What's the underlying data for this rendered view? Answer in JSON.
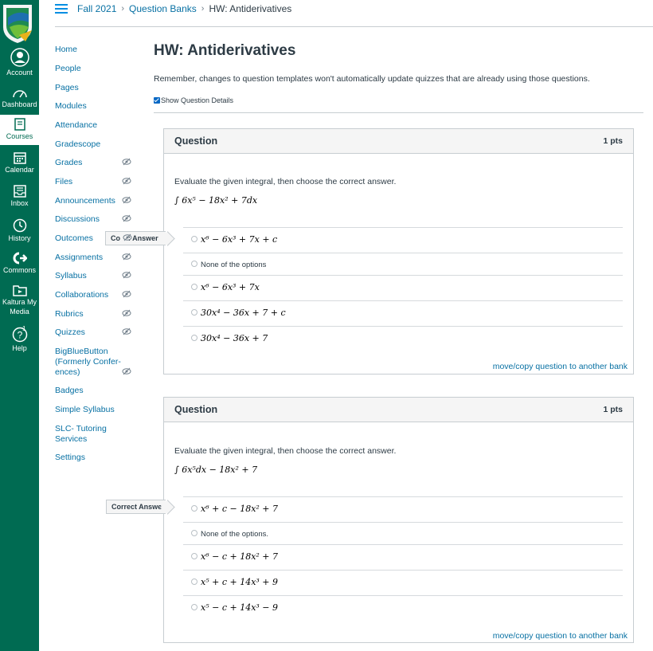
{
  "global_nav": {
    "items": [
      {
        "label": "Account",
        "icon": "account-icon"
      },
      {
        "label": "Dashboard",
        "icon": "dashboard-icon"
      },
      {
        "label": "Courses",
        "icon": "courses-icon"
      },
      {
        "label": "Calendar",
        "icon": "calendar-icon"
      },
      {
        "label": "Inbox",
        "icon": "inbox-icon"
      },
      {
        "label": "History",
        "icon": "history-icon"
      },
      {
        "label": "Commons",
        "icon": "commons-icon"
      },
      {
        "label": "Kaltura My Media",
        "icon": "kaltura-icon"
      },
      {
        "label": "Help",
        "icon": "help-icon",
        "badge": "1"
      }
    ],
    "active": "Courses",
    "colors": {
      "background": "#006b52",
      "accent": "#ffffff"
    }
  },
  "breadcrumb": {
    "items": [
      "Fall 2021",
      "Question Banks",
      "HW: Antiderivatives"
    ]
  },
  "course_nav": {
    "items": [
      {
        "label": "Home",
        "hidden": false
      },
      {
        "label": "People",
        "hidden": false
      },
      {
        "label": "Pages",
        "hidden": false
      },
      {
        "label": "Modules",
        "hidden": false
      },
      {
        "label": "Attendance",
        "hidden": false
      },
      {
        "label": "Gradescope",
        "hidden": false
      },
      {
        "label": "Grades",
        "hidden": true
      },
      {
        "label": "Files",
        "hidden": true
      },
      {
        "label": "Announcements",
        "hidden": true
      },
      {
        "label": "Discussions",
        "hidden": true
      },
      {
        "label": "Outcomes",
        "hidden": false
      },
      {
        "label": "Assignments",
        "hidden": true
      },
      {
        "label": "Syllabus",
        "hidden": true
      },
      {
        "label": "Collaborations",
        "hidden": true
      },
      {
        "label": "Rubrics",
        "hidden": true
      },
      {
        "label": "Quizzes",
        "hidden": true
      },
      {
        "label": "BigBlueButton (Formerly Confer-ences)",
        "hidden": true
      },
      {
        "label": "Badges",
        "hidden": false
      },
      {
        "label": "Simple Syllabus",
        "hidden": false
      },
      {
        "label": "SLC- Tutoring Services",
        "hidden": false
      },
      {
        "label": "Settings",
        "hidden": false
      }
    ]
  },
  "main": {
    "title": "HW: Antiderivatives",
    "note": "Remember, changes to question templates won't automatically update quizzes that are already using those questions.",
    "show_details_label": "Show Question Details",
    "show_details_checked": true,
    "questions": [
      {
        "header": "Question",
        "points": "1 pts",
        "text": "Evaluate the given integral, then choose the correct answer.",
        "formula": "∫ 6x⁵ − 18x² + 7dx",
        "flag": "Co    : Answer",
        "answers": [
          "x⁶ − 6x³ + 7x + c",
          "None of the options",
          "x⁶ − 6x³ + 7x",
          "30x⁴ − 36x + 7 + c",
          "30x⁴ − 36x + 7"
        ],
        "move_link": "move/copy question to another bank"
      },
      {
        "header": "Question",
        "points": "1 pts",
        "text": "Evaluate the given integral, then choose the correct answer.",
        "formula": "∫ 6x⁵dx − 18x² + 7",
        "flag": "Correct Answer",
        "answers": [
          "x⁶ + c − 18x² + 7",
          "None of the options.",
          "x⁶ − c + 18x² + 7",
          "x⁵ + c + 14x³ + 9",
          "x⁵ − c + 14x³ − 9"
        ],
        "move_link": "move/copy question to another bank"
      }
    ]
  }
}
